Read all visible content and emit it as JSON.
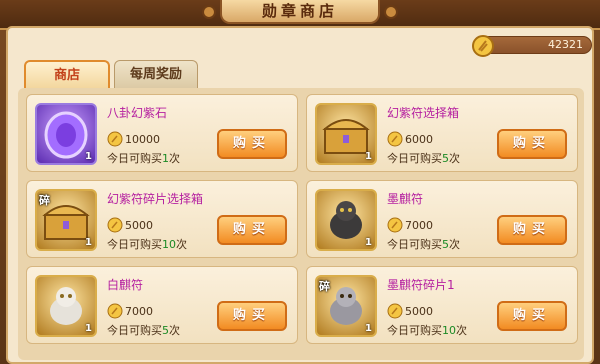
{
  "header": {
    "title": "勋章商店"
  },
  "currency": {
    "icon": "medal-coin-icon",
    "amount": "42321"
  },
  "tabs": [
    {
      "label": "商店",
      "active": true
    },
    {
      "label": "每周奖励",
      "active": false
    }
  ],
  "items": [
    {
      "name": "八卦幻紫石",
      "icon": "purple-stone-icon",
      "count": "1",
      "price": "10000",
      "limit_prefix": "今日可购买",
      "limit_num": "1",
      "limit_suffix": "次",
      "buy_label": "购买"
    },
    {
      "name": "幻紫符选择箱",
      "icon": "treasure-chest-icon",
      "count": "1",
      "price": "6000",
      "limit_prefix": "今日可购买",
      "limit_num": "5",
      "limit_suffix": "次",
      "buy_label": "购买"
    },
    {
      "name": "幻紫符碎片选择箱",
      "icon": "treasure-chest-shard-icon",
      "count": "1",
      "shard": "碎",
      "price": "5000",
      "limit_prefix": "今日可购买",
      "limit_num": "10",
      "limit_suffix": "次",
      "buy_label": "购买"
    },
    {
      "name": "墨麒符",
      "icon": "black-qilin-icon",
      "count": "1",
      "price": "7000",
      "limit_prefix": "今日可购买",
      "limit_num": "5",
      "limit_suffix": "次",
      "buy_label": "购买"
    },
    {
      "name": "白麒符",
      "icon": "white-qilin-icon",
      "count": "1",
      "price": "7000",
      "limit_prefix": "今日可购买",
      "limit_num": "5",
      "limit_suffix": "次",
      "buy_label": "购买"
    },
    {
      "name": "墨麒符碎片1",
      "icon": "silver-qilin-shard-icon",
      "count": "1",
      "shard": "碎",
      "price": "5000",
      "limit_prefix": "今日可购买",
      "limit_num": "10",
      "limit_suffix": "次",
      "buy_label": "购买"
    }
  ],
  "colors": {
    "item_name": "#b51fa0",
    "limit_number": "#1b8a25",
    "buy_button": "#f28b22",
    "active_tab_text": "#c3411a"
  }
}
